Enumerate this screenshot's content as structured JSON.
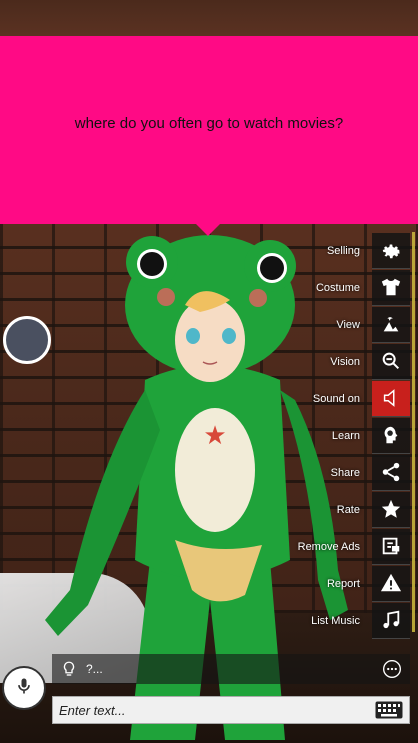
{
  "speech_bubble": {
    "text": "where do you often go to watch movies?"
  },
  "menu": {
    "items": [
      {
        "label": "Selling",
        "icon": "gear-icon"
      },
      {
        "label": "Costume",
        "icon": "shirt-icon"
      },
      {
        "label": "View",
        "icon": "landscape-icon"
      },
      {
        "label": "Vision",
        "icon": "zoom-out-icon"
      },
      {
        "label": "Sound on",
        "icon": "speaker-icon",
        "active": true
      },
      {
        "label": "Learn",
        "icon": "brain-head-icon"
      },
      {
        "label": "Share",
        "icon": "share-icon"
      },
      {
        "label": "Rate",
        "icon": "star-icon"
      },
      {
        "label": "Remove Ads",
        "icon": "remove-ads-icon"
      },
      {
        "label": "Report",
        "icon": "warning-icon"
      },
      {
        "label": "List Music",
        "icon": "music-note-icon"
      }
    ]
  },
  "suggestion": {
    "text": "?..."
  },
  "input": {
    "placeholder": "Enter text..."
  },
  "colors": {
    "bubble": "#ff0a85",
    "active_menu": "#c8201c",
    "frog_green": "#1fa33a"
  }
}
